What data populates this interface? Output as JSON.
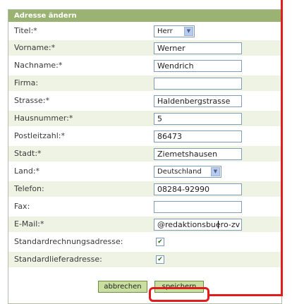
{
  "form": {
    "title": "Adresse ändern",
    "fields": [
      {
        "label": "Titel:*",
        "type": "select",
        "value": "Herr"
      },
      {
        "label": "Vorname:*",
        "type": "text",
        "value": "Werner"
      },
      {
        "label": "Nachname:*",
        "type": "text",
        "value": "Wendrich"
      },
      {
        "label": "Firma:",
        "type": "text",
        "value": ""
      },
      {
        "label": "Strasse:*",
        "type": "text",
        "value": "Haldenbergstrasse"
      },
      {
        "label": "Hausnummer:*",
        "type": "text",
        "value": "5"
      },
      {
        "label": "Postleitzahl:*",
        "type": "text",
        "value": "86473"
      },
      {
        "label": "Stadt:*",
        "type": "text",
        "value": "Ziemetshausen"
      },
      {
        "label": "Land:*",
        "type": "select",
        "value": "Deutschland"
      },
      {
        "label": "Telefon:",
        "type": "text",
        "value": "08284-92990"
      },
      {
        "label": "Fax:",
        "type": "text",
        "value": ""
      },
      {
        "label": "E-Mail:*",
        "type": "text",
        "value": "@redaktionsbuero-zv"
      },
      {
        "label": "Standardrechnungsadresse:",
        "type": "checkbox",
        "checked": true
      },
      {
        "label": "Standardlieferadresse:",
        "type": "checkbox",
        "checked": true
      }
    ]
  },
  "buttons": {
    "cancel_label": "abbrechen",
    "save_label": "speichern"
  },
  "colors": {
    "header_bg": "#9ab372",
    "row_shade": "#eef3e4",
    "button_bg": "#c9dfa0",
    "highlight": "#e01c1c"
  }
}
